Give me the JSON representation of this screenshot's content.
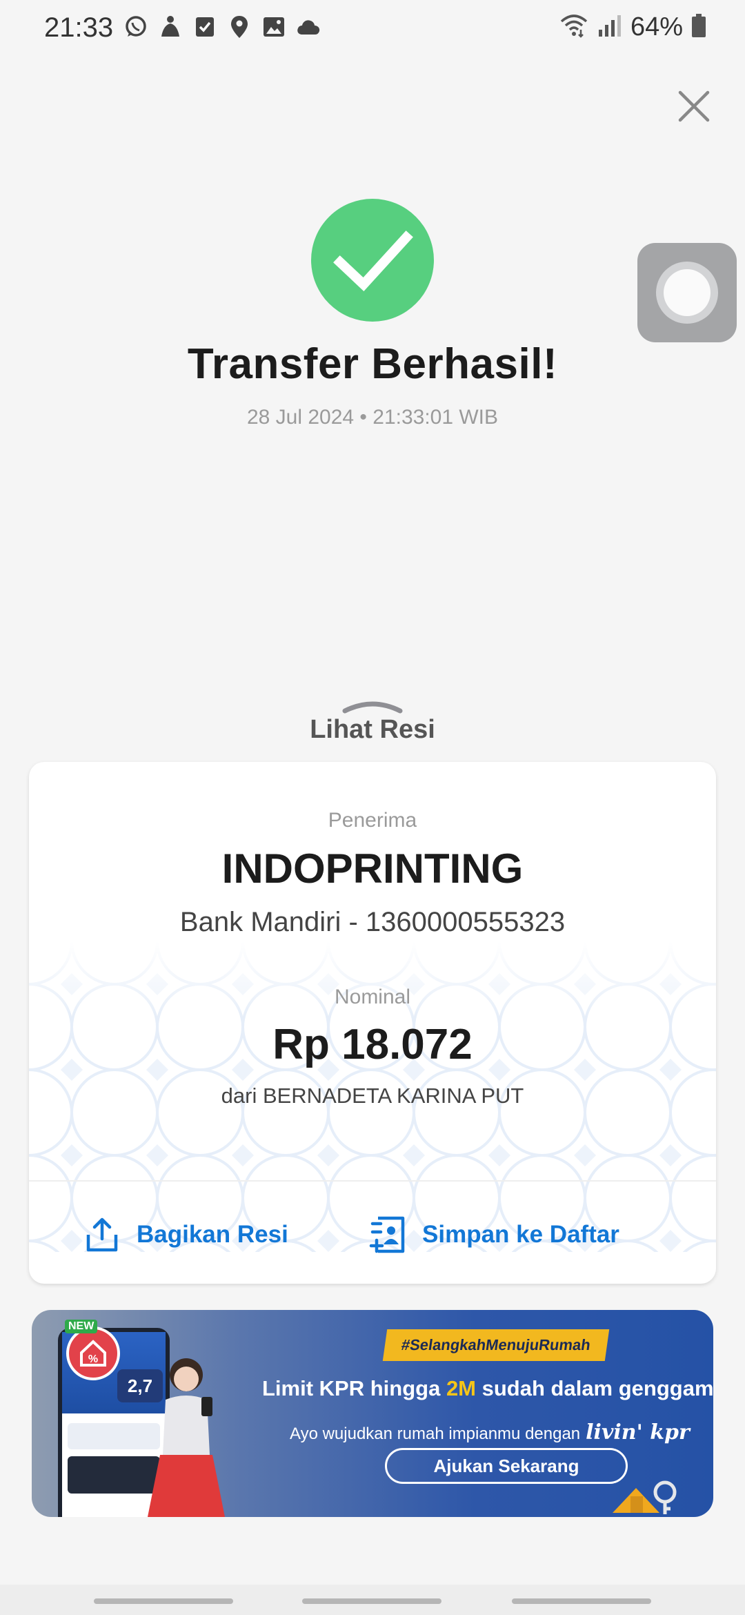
{
  "status_bar": {
    "time": "21:33",
    "battery": "64%",
    "left_icons": [
      "whatsapp-icon",
      "meditation-icon",
      "checkbox-icon",
      "location-icon",
      "gallery-icon",
      "cloud-icon"
    ],
    "right_icons": [
      "wifi-icon",
      "signal-icon",
      "battery-icon"
    ]
  },
  "header": {
    "close_icon": "close-icon"
  },
  "result": {
    "title": "Transfer Berhasil!",
    "timestamp": "28 Jul 2024 • 21:33:01 WIB",
    "success_color": "#57CF7F"
  },
  "sheet": {
    "handle_label": "Lihat Resi"
  },
  "receipt": {
    "recipient_label": "Penerima",
    "recipient_name": "INDOPRINTING",
    "bank_info": "Bank Mandiri - 1360000555323",
    "amount_label": "Nominal",
    "amount": "Rp 18.072",
    "sender": "dari BERNADETA KARINA PUT",
    "actions": {
      "share_label": "Bagikan Resi",
      "save_label": "Simpan ke Daftar"
    },
    "accent_color": "#1277D6"
  },
  "promo": {
    "new_badge": "NEW",
    "phone_badge": "2,7",
    "hashtag": "#SelangkahMenujuRumah",
    "headline_pre": "Limit KPR hingga ",
    "headline_highlight": "2M",
    "headline_post": " sudah dalam genggaman!",
    "subtext": "Ayo wujudkan rumah impianmu dengan",
    "brand": "livin' kpr",
    "cta": "Ajukan Sekarang"
  }
}
